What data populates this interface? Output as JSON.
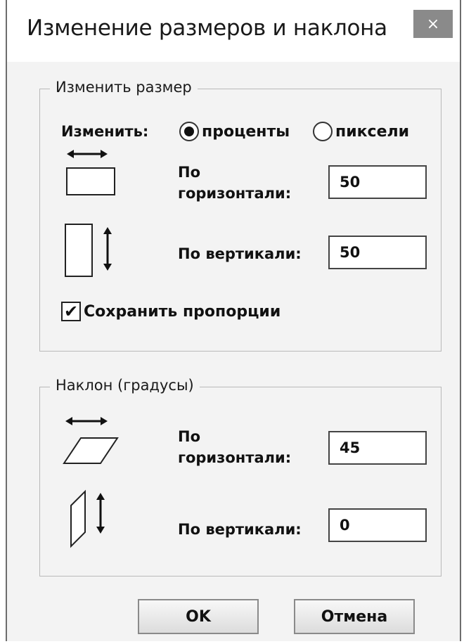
{
  "dialog": {
    "title": "Изменение размеров и наклона",
    "close_glyph": "×"
  },
  "resize_group": {
    "legend": "Изменить размер",
    "mode_label": "Изменить:",
    "mode_options": [
      {
        "label": "проценты",
        "selected": true
      },
      {
        "label": "пиксели",
        "selected": false
      }
    ],
    "horizontal": {
      "label_line1": "По",
      "label_line2": "горизонтали:",
      "value": "50"
    },
    "vertical": {
      "label": "По вертикали:",
      "value": "50"
    },
    "keep_aspect": {
      "label": "Сохранить пропорции",
      "checked": true,
      "check_glyph": "✔"
    }
  },
  "skew_group": {
    "legend": "Наклон (градусы)",
    "horizontal": {
      "label_line1": "По",
      "label_line2": "горизонтали:",
      "value": "45"
    },
    "vertical": {
      "label": "По вертикали:",
      "value": "0"
    }
  },
  "buttons": {
    "ok": "OK",
    "cancel": "Отмена"
  },
  "icons": [
    "resize-horizontal-icon",
    "resize-vertical-icon",
    "skew-horizontal-icon",
    "skew-vertical-icon",
    "close-icon"
  ]
}
